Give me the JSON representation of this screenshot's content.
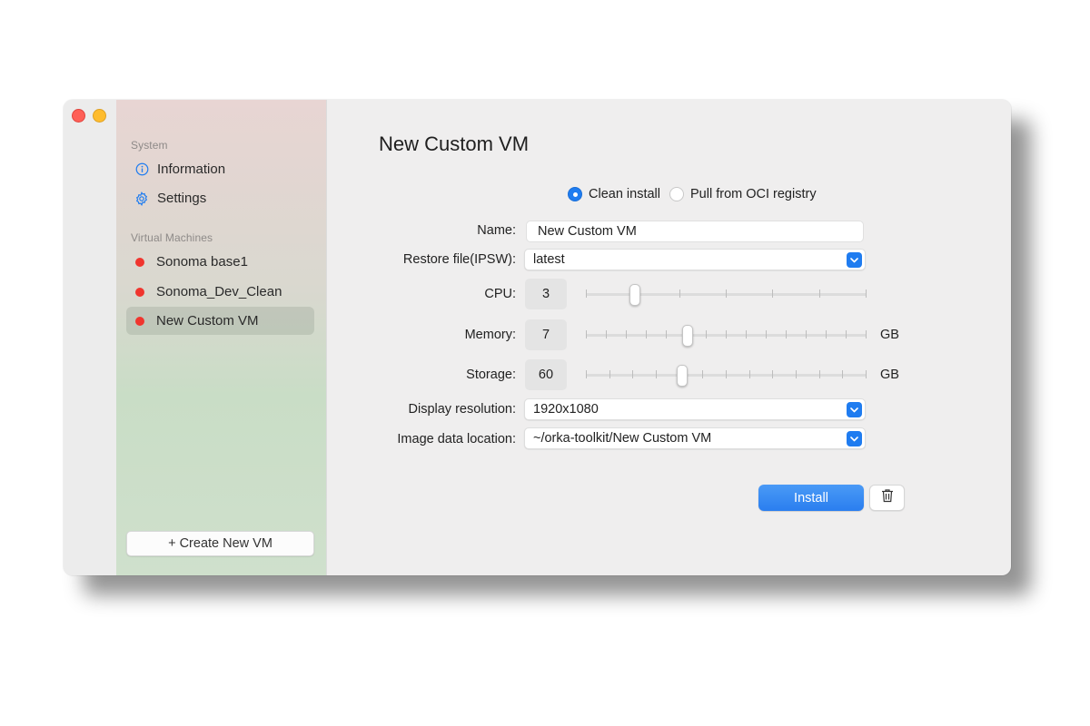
{
  "window": {
    "controls": [
      {
        "name": "close",
        "color": "#fe5f57"
      },
      {
        "name": "minimize",
        "color": "#febc2e"
      }
    ]
  },
  "sidebar": {
    "sections": [
      {
        "header": "System",
        "items": [
          {
            "label": "Information",
            "icon": "info-icon"
          },
          {
            "label": "Settings",
            "icon": "gear-icon"
          }
        ]
      },
      {
        "header": "Virtual Machines",
        "items": [
          {
            "label": "Sonoma base1",
            "icon": "status-dot-red"
          },
          {
            "label": "Sonoma_Dev_Clean",
            "icon": "status-dot-red"
          },
          {
            "label": "New Custom VM",
            "icon": "status-dot-red",
            "selected": true
          }
        ]
      }
    ],
    "create_button": "+ Create New VM"
  },
  "main": {
    "title": "New Custom VM",
    "install_mode": {
      "options": [
        "Clean install",
        "Pull from OCI registry"
      ],
      "selected": "Clean install"
    },
    "form": {
      "name": {
        "label": "Name:",
        "value": "New Custom VM"
      },
      "restore_file": {
        "label": "Restore file(IPSW):",
        "value": "latest"
      },
      "cpu": {
        "label": "CPU:",
        "value": "3",
        "level_fraction": 0.17,
        "ticks": 7
      },
      "memory": {
        "label": "Memory:",
        "value": "7",
        "unit": "GB",
        "level_fraction": 0.36,
        "ticks": 15
      },
      "storage": {
        "label": "Storage:",
        "value": "60",
        "unit": "GB",
        "level_fraction": 0.34,
        "ticks": 13
      },
      "display_resolution": {
        "label": "Display resolution:",
        "value": "1920x1080"
      },
      "image_location": {
        "label": "Image data location:",
        "value": "~/orka-toolkit/New Custom VM"
      }
    },
    "install_button": "Install",
    "delete_icon": "trash-icon"
  },
  "colors": {
    "accent": "#1f7cf0",
    "status_red": "#f0352e"
  }
}
